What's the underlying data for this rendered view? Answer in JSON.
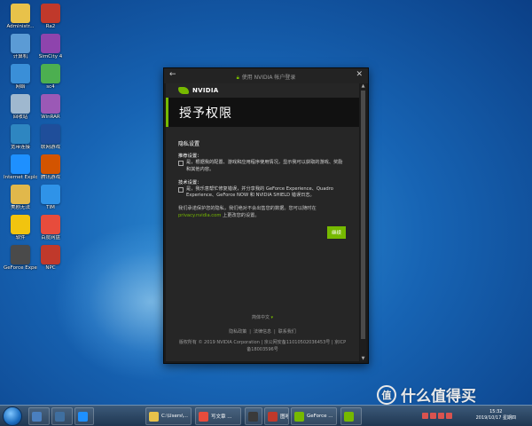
{
  "desktop": {
    "icons": [
      {
        "label": "Administr...",
        "color": "#e8c24a"
      },
      {
        "label": "Ra2",
        "color": "#c0392b"
      },
      {
        "label": "计算机",
        "color": "#5b9bd5"
      },
      {
        "label": "SimCity 4",
        "color": "#8e44ad"
      },
      {
        "label": "网络",
        "color": "#3a8fd8"
      },
      {
        "label": "sc4",
        "color": "#4caf50"
      },
      {
        "label": "回收站",
        "color": "#9fb8cf"
      },
      {
        "label": "WinRAR",
        "color": "#9b59b6"
      },
      {
        "label": "宽带连接",
        "color": "#2e86c1"
      },
      {
        "label": "联网游戏",
        "color": "#1f4e9a"
      },
      {
        "label": "Internet Explorer",
        "color": "#1e90ff"
      },
      {
        "label": "腾讯游戏",
        "color": "#d35400"
      },
      {
        "label": "美剧无法",
        "color": "#e1b84b"
      },
      {
        "label": "TIM",
        "color": "#2f93e8"
      },
      {
        "label": "软件",
        "color": "#f1c40f"
      },
      {
        "label": "百度网盘",
        "color": "#e74c3c"
      },
      {
        "label": "GeForce Experience",
        "color": "#4a4a4a"
      },
      {
        "label": "NPC",
        "color": "#c0392b"
      }
    ]
  },
  "dialog": {
    "back_glyph": "←",
    "title": "使用 NVIDIA 帐户登录",
    "close_glyph": "✕",
    "logo_text": "NVIDIA",
    "hero_title": "授予权限",
    "privacy_heading": "隐私设置",
    "recommended_label": "推荐设置：",
    "recommended_text": "是，根据我的配置、游戏和应用程序使用情况，显示我可以获取的游戏、奖励和其他内容。",
    "technical_label": "技术设置：",
    "technical_text": "是，我乐意帮忙修复错误，并分享我的 GeForce Experience、Quadro Experience、GeForce NOW 和 NVIDIA SHIELD 错误日志。",
    "note_text": "我们承诺保护您的隐私，我们绝对不会出售您的数据。您可以随时在",
    "note_link": "privacy.nvidia.com",
    "note_tail": "上更改您的设置。",
    "continue_label": "继续",
    "language": "简体中文",
    "footer_links": [
      "隐私政策",
      "法律信息",
      "联系我们"
    ],
    "copyright": "版权所有 © 2019 NVIDIA Corporation | 京公网安备11010502036453号 | 京ICP备18003596号"
  },
  "taskbar": {
    "items": [
      {
        "label": "",
        "color": "#4a7fbf"
      },
      {
        "label": "",
        "color": "#3f6fa0"
      },
      {
        "label": "",
        "color": "#1e90ff"
      },
      {
        "label": "C:\\Users\\...",
        "color": "#e8c24a"
      },
      {
        "label": "写文章 ...",
        "color": "#e74c3c"
      },
      {
        "label": "",
        "color": "#3a3a3a"
      },
      {
        "label": "图吧工具箱",
        "color": "#c0392b"
      },
      {
        "label": "GeForce ...",
        "color": "#76b900"
      },
      {
        "label": "",
        "color": "#76b900"
      }
    ],
    "time": "15:32",
    "date": "2019/10/17 星期四"
  },
  "watermark": {
    "badge": "值",
    "text": "什么值得买"
  },
  "colors": {
    "accent": "#76b900",
    "dialog_bg": "#262626"
  }
}
